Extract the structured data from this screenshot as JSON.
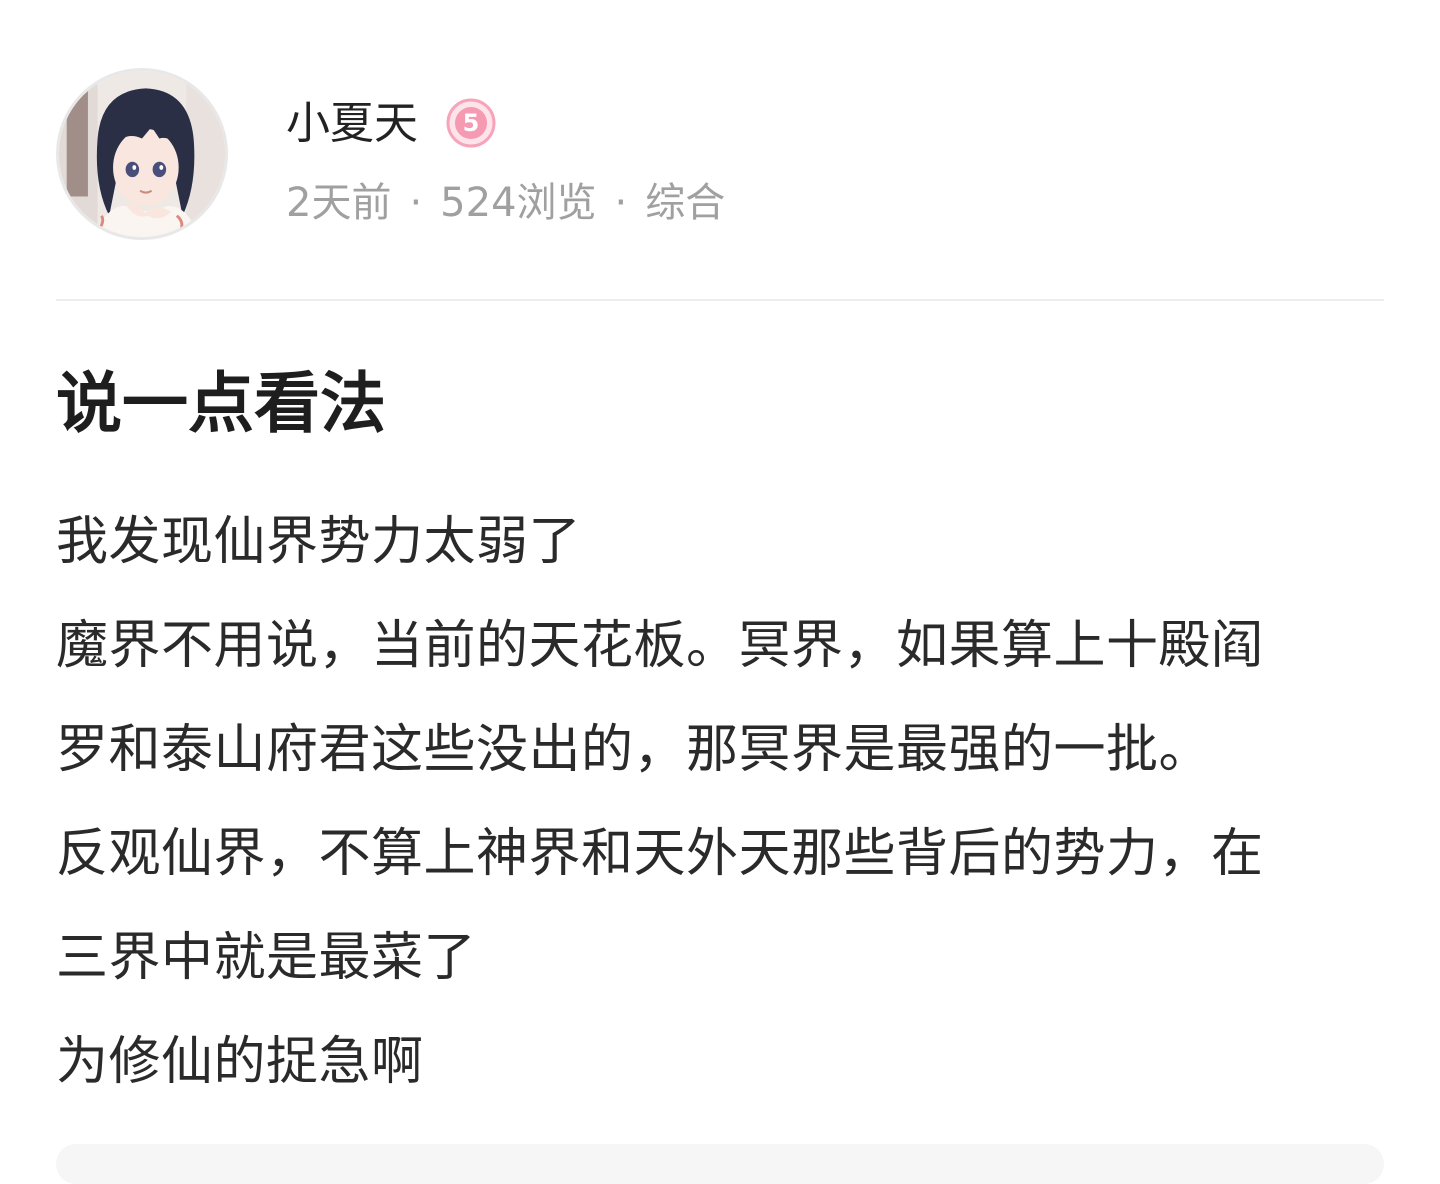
{
  "author": {
    "name": "小夏天",
    "level": "5",
    "avatar_icon": "anime-avatar-icon",
    "badge_color": "#f7a3b9"
  },
  "meta": {
    "time": "2天前",
    "separator": "·",
    "views": "524浏览",
    "category": "综合"
  },
  "post": {
    "title": "说一点看法",
    "lines": [
      "我发现仙界势力太弱了",
      "魔界不用说，当前的天花板。冥界，如果算上十殿阎",
      "罗和泰山府君这些没出的，那冥界是最强的一批。",
      "反观仙界，不算上神界和天外天那些背后的势力，在",
      "三界中就是最菜了",
      "为修仙的捉急啊"
    ]
  }
}
